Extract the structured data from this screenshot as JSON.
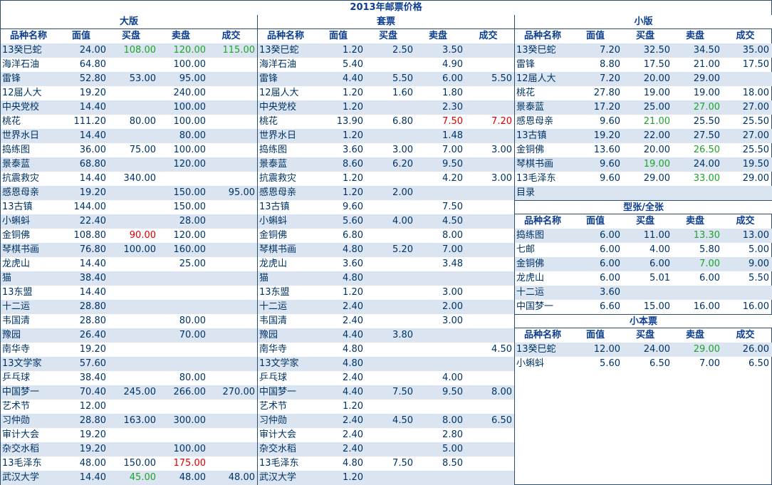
{
  "title": "2013年邮票价格",
  "headers": [
    "品种名称",
    "面值",
    "买盘",
    "卖盘",
    "成交"
  ],
  "colors": {
    "green": "#1fa32a",
    "red": "#e00000",
    "row_alt": "#dbe5f1",
    "text": "#003366"
  },
  "sections": {
    "left": {
      "title": "大版",
      "rows": [
        {
          "name": "13癸巳蛇",
          "face": "24.00",
          "bid": "108.00",
          "ask": "120.00",
          "deal": "115.00",
          "bid_color": "green",
          "ask_color": "green",
          "deal_color": "green"
        },
        {
          "name": "海洋石油",
          "face": "64.80",
          "bid": "",
          "ask": "100.00",
          "deal": ""
        },
        {
          "name": "雷锋",
          "face": "52.80",
          "bid": "53.00",
          "ask": "95.00",
          "deal": ""
        },
        {
          "name": "12届人大",
          "face": "19.20",
          "bid": "",
          "ask": "240.00",
          "deal": ""
        },
        {
          "name": "中央党校",
          "face": "14.40",
          "bid": "",
          "ask": "100.00",
          "deal": ""
        },
        {
          "name": "桃花",
          "face": "111.20",
          "bid": "80.00",
          "ask": "100.00",
          "deal": ""
        },
        {
          "name": "世界水日",
          "face": "14.40",
          "bid": "",
          "ask": "80.00",
          "deal": ""
        },
        {
          "name": "捣练图",
          "face": "36.00",
          "bid": "75.00",
          "ask": "100.00",
          "deal": ""
        },
        {
          "name": "景泰蓝",
          "face": "68.80",
          "bid": "",
          "ask": "120.00",
          "deal": ""
        },
        {
          "name": "抗震救灾",
          "face": "14.40",
          "bid": "340.00",
          "ask": "",
          "deal": ""
        },
        {
          "name": "感恩母亲",
          "face": "19.20",
          "bid": "",
          "ask": "150.00",
          "deal": "95.00"
        },
        {
          "name": "13古镇",
          "face": "144.00",
          "bid": "",
          "ask": "150.00",
          "deal": ""
        },
        {
          "name": "小蝌蚪",
          "face": "22.40",
          "bid": "",
          "ask": "28.00",
          "deal": ""
        },
        {
          "name": "金铜佛",
          "face": "108.80",
          "bid": "90.00",
          "ask": "120.00",
          "deal": "",
          "bid_color": "red"
        },
        {
          "name": "琴棋书画",
          "face": "76.80",
          "bid": "100.00",
          "ask": "160.00",
          "deal": ""
        },
        {
          "name": "龙虎山",
          "face": "14.40",
          "bid": "",
          "ask": "25.00",
          "deal": ""
        },
        {
          "name": "猫",
          "face": "38.40",
          "bid": "",
          "ask": "",
          "deal": ""
        },
        {
          "name": "13东盟",
          "face": "14.40",
          "bid": "",
          "ask": "",
          "deal": ""
        },
        {
          "name": "十二运",
          "face": "28.80",
          "bid": "",
          "ask": "",
          "deal": ""
        },
        {
          "name": "韦国清",
          "face": "28.80",
          "bid": "",
          "ask": "80.00",
          "deal": ""
        },
        {
          "name": "豫园",
          "face": "26.40",
          "bid": "",
          "ask": "70.00",
          "deal": ""
        },
        {
          "name": "南华寺",
          "face": "19.20",
          "bid": "",
          "ask": "",
          "deal": ""
        },
        {
          "name": "13文学家",
          "face": "57.60",
          "bid": "",
          "ask": "",
          "deal": ""
        },
        {
          "name": "乒乓球",
          "face": "38.40",
          "bid": "",
          "ask": "80.00",
          "deal": ""
        },
        {
          "name": "中国梦一",
          "face": "70.40",
          "bid": "245.00",
          "ask": "266.00",
          "deal": "270.00"
        },
        {
          "name": "艺术节",
          "face": "12.00",
          "bid": "",
          "ask": "",
          "deal": ""
        },
        {
          "name": "习仲勋",
          "face": "28.80",
          "bid": "163.00",
          "ask": "300.00",
          "deal": ""
        },
        {
          "name": "审计大会",
          "face": "19.20",
          "bid": "",
          "ask": "",
          "deal": ""
        },
        {
          "name": "杂交水稻",
          "face": "19.20",
          "bid": "",
          "ask": "100.00",
          "deal": ""
        },
        {
          "name": "13毛泽东",
          "face": "48.00",
          "bid": "150.00",
          "ask": "175.00",
          "deal": "",
          "ask_color": "red"
        },
        {
          "name": "武汉大学",
          "face": "14.40",
          "bid": "45.00",
          "ask": "48.00",
          "deal": "48.00",
          "bid_color": "green"
        }
      ]
    },
    "middle": {
      "title": "套票",
      "rows": [
        {
          "name": "13癸巳蛇",
          "face": "1.20",
          "bid": "2.50",
          "ask": "3.50",
          "deal": ""
        },
        {
          "name": "海洋石油",
          "face": "5.40",
          "bid": "",
          "ask": "4.90",
          "deal": ""
        },
        {
          "name": "雷锋",
          "face": "4.40",
          "bid": "5.50",
          "ask": "6.00",
          "deal": "5.50"
        },
        {
          "name": "12届人大",
          "face": "1.20",
          "bid": "1.60",
          "ask": "1.80",
          "deal": ""
        },
        {
          "name": "中央党校",
          "face": "1.20",
          "bid": "",
          "ask": "2.30",
          "deal": ""
        },
        {
          "name": "桃花",
          "face": "13.90",
          "bid": "6.80",
          "ask": "7.50",
          "deal": "7.20",
          "ask_color": "red",
          "deal_color": "red"
        },
        {
          "name": "世界水日",
          "face": "1.20",
          "bid": "",
          "ask": "1.48",
          "deal": ""
        },
        {
          "name": "捣练图",
          "face": "3.60",
          "bid": "3.00",
          "ask": "7.00",
          "deal": "3.00"
        },
        {
          "name": "景泰蓝",
          "face": "8.60",
          "bid": "6.20",
          "ask": "9.50",
          "deal": ""
        },
        {
          "name": "抗震救灾",
          "face": "1.20",
          "bid": "",
          "ask": "4.20",
          "deal": "3.00"
        },
        {
          "name": "感恩母亲",
          "face": "1.20",
          "bid": "2.00",
          "ask": "",
          "deal": ""
        },
        {
          "name": "13古镇",
          "face": "9.60",
          "bid": "",
          "ask": "7.50",
          "deal": ""
        },
        {
          "name": "小蝌蚪",
          "face": "5.60",
          "bid": "4.00",
          "ask": "4.50",
          "deal": ""
        },
        {
          "name": "金铜佛",
          "face": "6.80",
          "bid": "",
          "ask": "8.00",
          "deal": ""
        },
        {
          "name": "琴棋书画",
          "face": "4.80",
          "bid": "5.20",
          "ask": "7.00",
          "deal": ""
        },
        {
          "name": "龙虎山",
          "face": "3.60",
          "bid": "",
          "ask": "3.48",
          "deal": ""
        },
        {
          "name": "猫",
          "face": "4.80",
          "bid": "",
          "ask": "",
          "deal": ""
        },
        {
          "name": "13东盟",
          "face": "1.20",
          "bid": "",
          "ask": "3.00",
          "deal": ""
        },
        {
          "name": "十二运",
          "face": "2.40",
          "bid": "",
          "ask": "2.00",
          "deal": ""
        },
        {
          "name": "韦国清",
          "face": "2.40",
          "bid": "",
          "ask": "3.00",
          "deal": ""
        },
        {
          "name": "豫园",
          "face": "4.40",
          "bid": "3.80",
          "ask": "",
          "deal": ""
        },
        {
          "name": "南华寺",
          "face": "4.80",
          "bid": "",
          "ask": "",
          "deal": "4.50"
        },
        {
          "name": "13文学家",
          "face": "4.80",
          "bid": "",
          "ask": "",
          "deal": ""
        },
        {
          "name": "乒乓球",
          "face": "2.40",
          "bid": "",
          "ask": "4.00",
          "deal": ""
        },
        {
          "name": "中国梦一",
          "face": "4.40",
          "bid": "7.50",
          "ask": "9.50",
          "deal": "8.00"
        },
        {
          "name": "艺术节",
          "face": "1.20",
          "bid": "",
          "ask": "",
          "deal": ""
        },
        {
          "name": "习仲勋",
          "face": "2.40",
          "bid": "4.50",
          "ask": "8.00",
          "deal": "6.50"
        },
        {
          "name": "审计大会",
          "face": "2.40",
          "bid": "",
          "ask": "2.80",
          "deal": ""
        },
        {
          "name": "杂交水稻",
          "face": "2.40",
          "bid": "",
          "ask": "5.00",
          "deal": ""
        },
        {
          "name": "13毛泽东",
          "face": "4.80",
          "bid": "7.50",
          "ask": "8.50",
          "deal": ""
        },
        {
          "name": "武汉大学",
          "face": "1.20",
          "bid": "",
          "ask": "",
          "deal": ""
        }
      ]
    },
    "right_small": {
      "title": "小版",
      "rows": [
        {
          "name": "13癸巳蛇",
          "face": "7.20",
          "bid": "32.50",
          "ask": "34.50",
          "deal": "35.00"
        },
        {
          "name": "雷锋",
          "face": "8.80",
          "bid": "17.50",
          "ask": "21.00",
          "deal": "17.50"
        },
        {
          "name": "12届人大",
          "face": "7.20",
          "bid": "20.00",
          "ask": "29.00",
          "deal": ""
        },
        {
          "name": "桃花",
          "face": "27.80",
          "bid": "19.00",
          "ask": "19.00",
          "deal": "18.00"
        },
        {
          "name": "景泰蓝",
          "face": "17.20",
          "bid": "25.00",
          "ask": "27.00",
          "deal": "27.00",
          "ask_color": "green"
        },
        {
          "name": "感恩母亲",
          "face": "9.60",
          "bid": "21.00",
          "ask": "25.50",
          "deal": "25.50",
          "bid_color": "green"
        },
        {
          "name": "13古镇",
          "face": "19.20",
          "bid": "22.00",
          "ask": "27.50",
          "deal": "27.00"
        },
        {
          "name": "金铜佛",
          "face": "13.60",
          "bid": "20.00",
          "ask": "26.50",
          "deal": "25.50",
          "ask_color": "green"
        },
        {
          "name": "琴棋书画",
          "face": "9.60",
          "bid": "19.00",
          "ask": "24.00",
          "deal": "19.50",
          "bid_color": "green"
        },
        {
          "name": "13毛泽东",
          "face": "9.60",
          "bid": "29.00",
          "ask": "33.00",
          "deal": "29.00",
          "ask_color": "green"
        },
        {
          "name": "目录",
          "face": "",
          "bid": "",
          "ask": "",
          "deal": ""
        }
      ]
    },
    "right_sheet": {
      "title": "型张/全张",
      "rows": [
        {
          "name": "捣练图",
          "face": "6.00",
          "bid": "11.00",
          "ask": "13.30",
          "deal": "13.00",
          "ask_color": "green"
        },
        {
          "name": "七邮",
          "face": "6.00",
          "bid": "4.00",
          "ask": "5.80",
          "deal": "5.00"
        },
        {
          "name": "金铜佛",
          "face": "6.00",
          "bid": "6.00",
          "ask": "7.00",
          "deal": "9.00",
          "ask_color": "green"
        },
        {
          "name": "龙虎山",
          "face": "6.00",
          "bid": "5.01",
          "ask": "6.00",
          "deal": "5.50"
        },
        {
          "name": "十二运",
          "face": "3.60",
          "bid": "",
          "ask": "",
          "deal": ""
        },
        {
          "name": "中国梦一",
          "face": "6.60",
          "bid": "15.00",
          "ask": "16.00",
          "deal": "16.00"
        }
      ]
    },
    "right_booklet": {
      "title": "小本票",
      "rows": [
        {
          "name": "13癸巳蛇",
          "face": "12.00",
          "bid": "24.00",
          "ask": "29.00",
          "deal": "26.00",
          "ask_color": "green"
        },
        {
          "name": "小蝌蚪",
          "face": "5.60",
          "bid": "6.50",
          "ask": "7.00",
          "deal": "6.50"
        }
      ]
    }
  }
}
